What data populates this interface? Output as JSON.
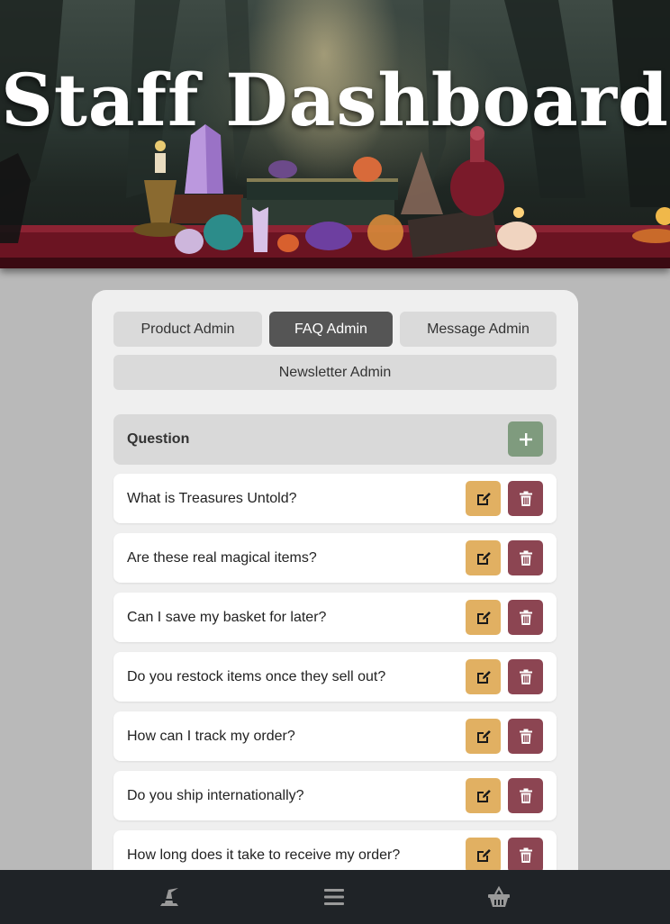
{
  "hero": {
    "title": "Staff Dashboard"
  },
  "tabs": [
    {
      "label": "Product Admin",
      "active": false
    },
    {
      "label": "FAQ Admin",
      "active": true
    },
    {
      "label": "Message Admin",
      "active": false
    },
    {
      "label": "Newsletter Admin",
      "active": false
    }
  ],
  "faq_table": {
    "header": "Question",
    "add_icon": "plus-icon",
    "rows": [
      {
        "question": "What is Treasures Untold?"
      },
      {
        "question": "Are these real magical items?"
      },
      {
        "question": "Can I save my basket for later?"
      },
      {
        "question": "Do you restock items once they sell out?"
      },
      {
        "question": "How can I track my order?"
      },
      {
        "question": "Do you ship internationally?"
      },
      {
        "question": "How long does it take to receive my order?"
      }
    ],
    "edit_icon": "edit-icon",
    "delete_icon": "trash-icon"
  },
  "bottom_nav": {
    "items": [
      {
        "icon": "witch-hat-icon"
      },
      {
        "icon": "menu-icon"
      },
      {
        "icon": "basket-icon"
      }
    ]
  },
  "colors": {
    "page_bg": "#b9b9b9",
    "panel_bg": "#efefef",
    "tab_bg": "#dadada",
    "tab_active_bg": "#555555",
    "add_button": "#7f9b7e",
    "edit_button": "#e1b062",
    "delete_button": "#8c4552",
    "nav_bg": "#1f2327"
  }
}
